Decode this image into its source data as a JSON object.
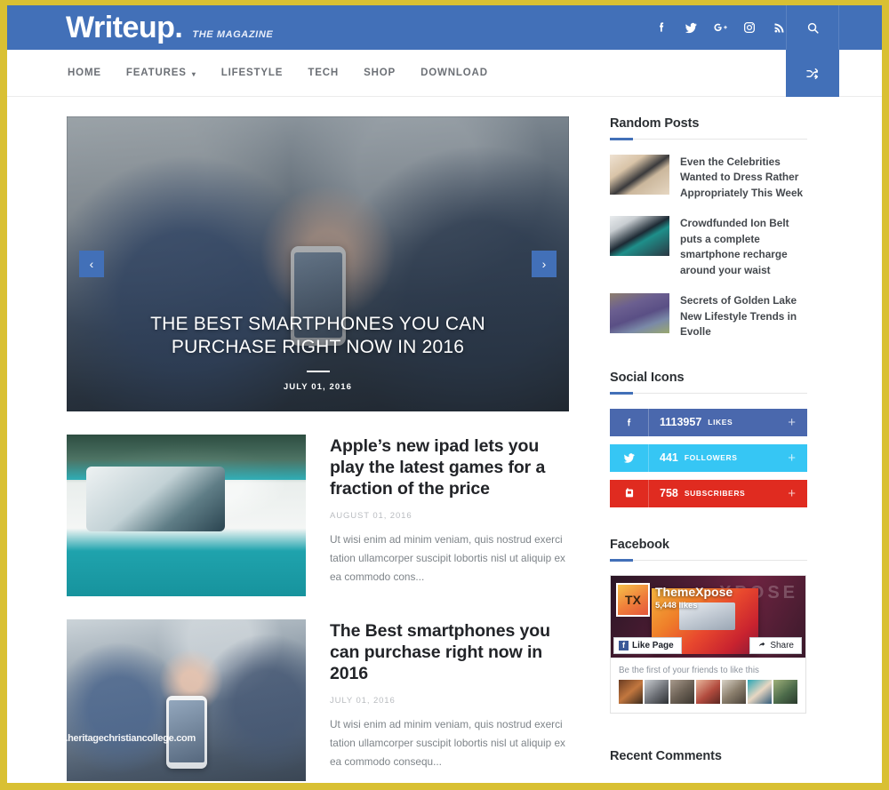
{
  "header": {
    "logo": "Writeup.",
    "tagline": "THE MAGAZINE",
    "social": [
      {
        "name": "facebook-icon",
        "glyph": "f"
      },
      {
        "name": "twitter-icon",
        "glyph": "\u0000"
      },
      {
        "name": "google-plus-icon",
        "glyph": "G+"
      },
      {
        "name": "instagram-icon",
        "glyph": "\u0000"
      },
      {
        "name": "rss-icon",
        "glyph": "\u0000"
      }
    ],
    "search_label": "search-icon",
    "shuffle_label": "random-post-icon"
  },
  "nav": {
    "items": [
      {
        "label": "HOME",
        "has_caret": false
      },
      {
        "label": "FEATURES",
        "has_caret": true
      },
      {
        "label": "LIFESTYLE",
        "has_caret": false
      },
      {
        "label": "TECH",
        "has_caret": false
      },
      {
        "label": "SHOP",
        "has_caret": false
      },
      {
        "label": "DOWNLOAD",
        "has_caret": false
      }
    ],
    "caret": "▾"
  },
  "hero": {
    "title": "THE BEST SMARTPHONES YOU CAN PURCHASE RIGHT NOW IN 2016",
    "date": "JULY 01, 2016",
    "prev": "‹",
    "next": "›"
  },
  "posts": [
    {
      "title": "Apple’s new ipad lets you play the latest games for a fraction of the price",
      "date": "AUGUST 01, 2016",
      "excerpt": "Ut wisi enim ad minim veniam, quis nostrud exerci tation ullamcorper suscipit lobortis nisl ut aliquip ex ea commodo cons..."
    },
    {
      "title": "The Best smartphones you can purchase right now in 2016",
      "date": "JULY 01, 2016",
      "excerpt": "Ut wisi enim ad minim veniam, quis nostrud exerci tation ullamcorper suscipit lobortis nisl ut aliquip ex ea commodo consequ..."
    }
  ],
  "watermark": "www.heritagechristiancollege.com",
  "sidebar": {
    "random_posts": {
      "title": "Random Posts",
      "items": [
        {
          "title": "Even the Celebrities Wanted to Dress Rather Appropriately This Week"
        },
        {
          "title": "Crowdfunded Ion Belt puts a complete smartphone recharge around your waist"
        },
        {
          "title": "Secrets of Golden Lake New Lifestyle Trends in Evolle"
        }
      ]
    },
    "social_icons": {
      "title": "Social Icons",
      "items": [
        {
          "network": "facebook",
          "count": "1113957",
          "label": "LIKES",
          "color": "#4a68ad",
          "plus": "+"
        },
        {
          "network": "twitter",
          "count": "441",
          "label": "FOLLOWERS",
          "color": "#36c6f4",
          "plus": "+"
        },
        {
          "network": "youtube",
          "count": "758",
          "label": "SUBSCRIBERS",
          "color": "#e02b20",
          "plus": "+"
        }
      ]
    },
    "facebook": {
      "title": "Facebook",
      "page_name": "ThemeXpose",
      "likes": "5,448 likes",
      "cover_ghost": "XPOSE",
      "avatar_text": "TX",
      "like_button": "Like Page",
      "share_button": "Share",
      "footer_text": "Be the first of your friends to like this"
    },
    "recent_comments": {
      "title": "Recent Comments"
    }
  },
  "colors": {
    "header_blue": "#4270B8",
    "frame_gold": "#D9C033",
    "accent": "#4270B8"
  }
}
